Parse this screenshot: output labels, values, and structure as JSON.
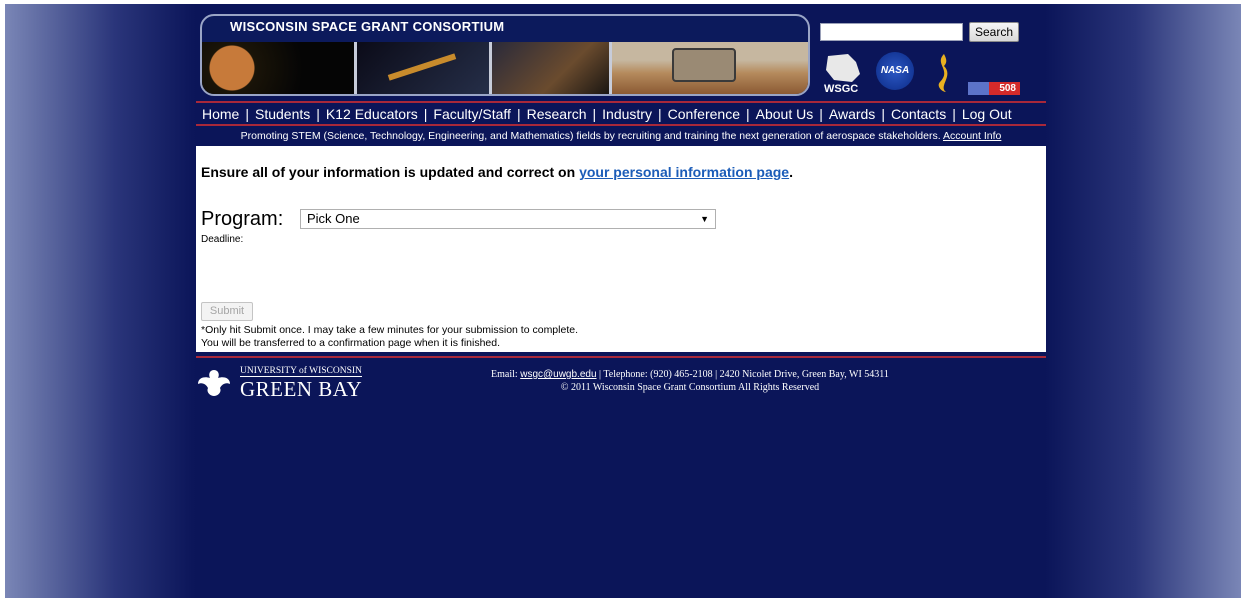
{
  "header": {
    "banner_title": "WISCONSIN SPACE GRANT CONSORTIUM",
    "search_placeholder": "",
    "search_button": "Search",
    "nasa_label": "NASA",
    "badge_508": "508"
  },
  "nav": {
    "items": [
      "Home",
      "Students",
      "K12 Educators",
      "Faculty/Staff",
      "Research",
      "Industry",
      "Conference",
      "About Us",
      "Awards",
      "Contacts",
      "Log Out"
    ]
  },
  "tagline": {
    "text": "Promoting STEM (Science, Technology, Engineering, and Mathematics) fields by recruiting and training the next generation of aerospace stakeholders.",
    "account_link": "Account Info"
  },
  "main": {
    "notice_text": "Ensure all of your information is updated and correct on ",
    "notice_link": "your personal information page",
    "notice_end": ".",
    "program_label": "Program:",
    "program_selected": "Pick One",
    "deadline_label": "Deadline:",
    "submit_label": "Submit",
    "note_line1": "*Only hit Submit once.  I may take a few minutes for your submission to complete.",
    "note_line2": "You will be transferred to a confirmation page when it is finished."
  },
  "footer": {
    "uwgb_top": "UNIVERSITY of WISCONSIN",
    "uwgb_main": "GREEN BAY",
    "email_label": "Email: ",
    "email": "wsgc@uwgb.edu",
    "contact_rest": " | Telephone: (920) 465-2108 | 2420 Nicolet Drive, Green Bay, WI 54311",
    "copyright": "© 2011 Wisconsin Space Grant Consortium All Rights Reserved"
  },
  "colors": {
    "background": "#0b1559",
    "accent_rule": "#a8283a",
    "link": "#1b5cb8"
  }
}
